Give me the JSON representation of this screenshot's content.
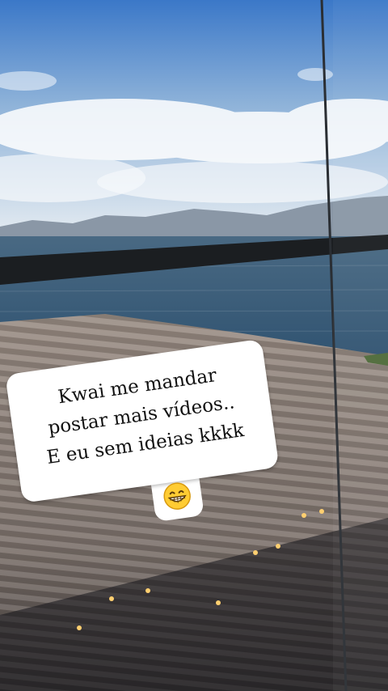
{
  "caption": {
    "line1": "Kwai me mandar",
    "line2": "postar mais vídeos..",
    "line3": "E eu sem ideias kkkk",
    "emoji": "grinning-face-icon"
  },
  "colors": {
    "sky_top": "#3f7fd0",
    "sky_bottom": "#dfe8f0",
    "sea": "#3c5f7e",
    "roof": "#8a7f78",
    "railing": "#1c1f22"
  }
}
